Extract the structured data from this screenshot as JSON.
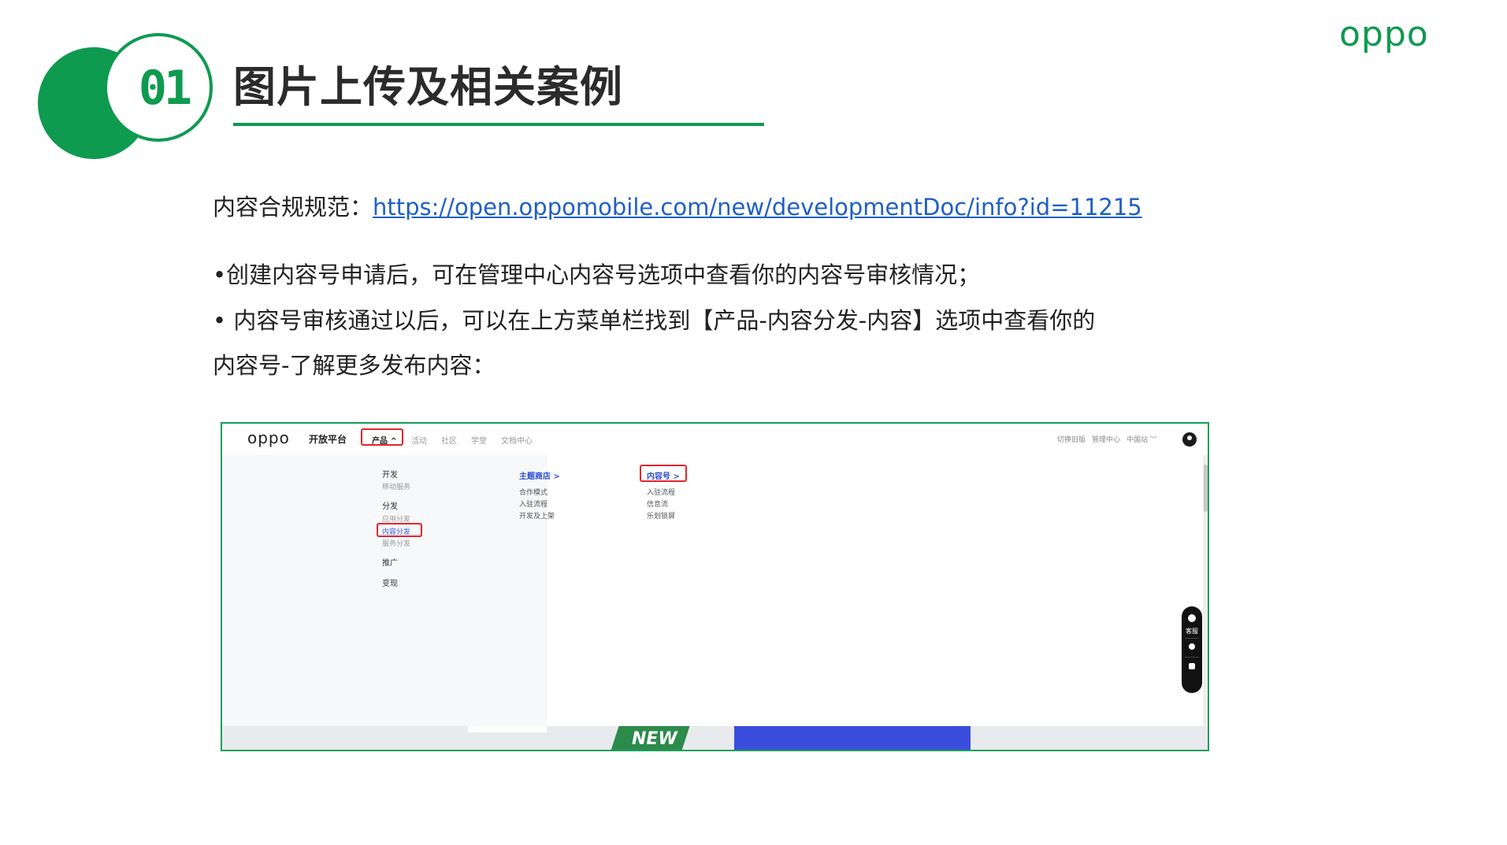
{
  "slide": {
    "number": "01",
    "title": "图片上传及相关案例",
    "brand": "oppo",
    "accent_color": "#0e9a4f"
  },
  "content": {
    "compliance_label": "内容合规规范：",
    "compliance_url": "https://open.oppomobile.com/new/developmentDoc/info?id=11215",
    "bullet1": "•创建内容号申请后，可在管理中心内容号选项中查看你的内容号审核情况；",
    "bullet2_line1": "• 内容号审核通过以后，可以在上方菜单栏找到【产品-内容分发-内容】选项中查看你的",
    "bullet2_line2": "内容号-了解更多发布内容："
  },
  "screenshot": {
    "logo": "oppo",
    "platform": "开放平台",
    "nav": {
      "product": "产品 ^",
      "activity": "活动",
      "community": "社区",
      "academy": "学堂",
      "docs": "文档中心"
    },
    "right_nav": {
      "old_version": "切换旧版",
      "manage": "管理中心",
      "region": "中国站 ﹀"
    },
    "menu": {
      "dev": "开发",
      "mobile_service": "移动服务",
      "distribution": "分发",
      "app_distribution": "应用分发",
      "content_distribution": "内容分发",
      "service_distribution": "服务分发",
      "promotion": "推广",
      "monetize": "变现"
    },
    "col1": {
      "title": "主题商店  >",
      "items": [
        "合作模式",
        "入驻流程",
        "开发及上架"
      ]
    },
    "col2": {
      "title": "内容号  >",
      "items": [
        "入驻流程",
        "信息流",
        "乐划锁屏"
      ]
    },
    "float": {
      "service": "客服"
    },
    "banner_badge": "NEW",
    "highlight_color": "#e3262f"
  }
}
